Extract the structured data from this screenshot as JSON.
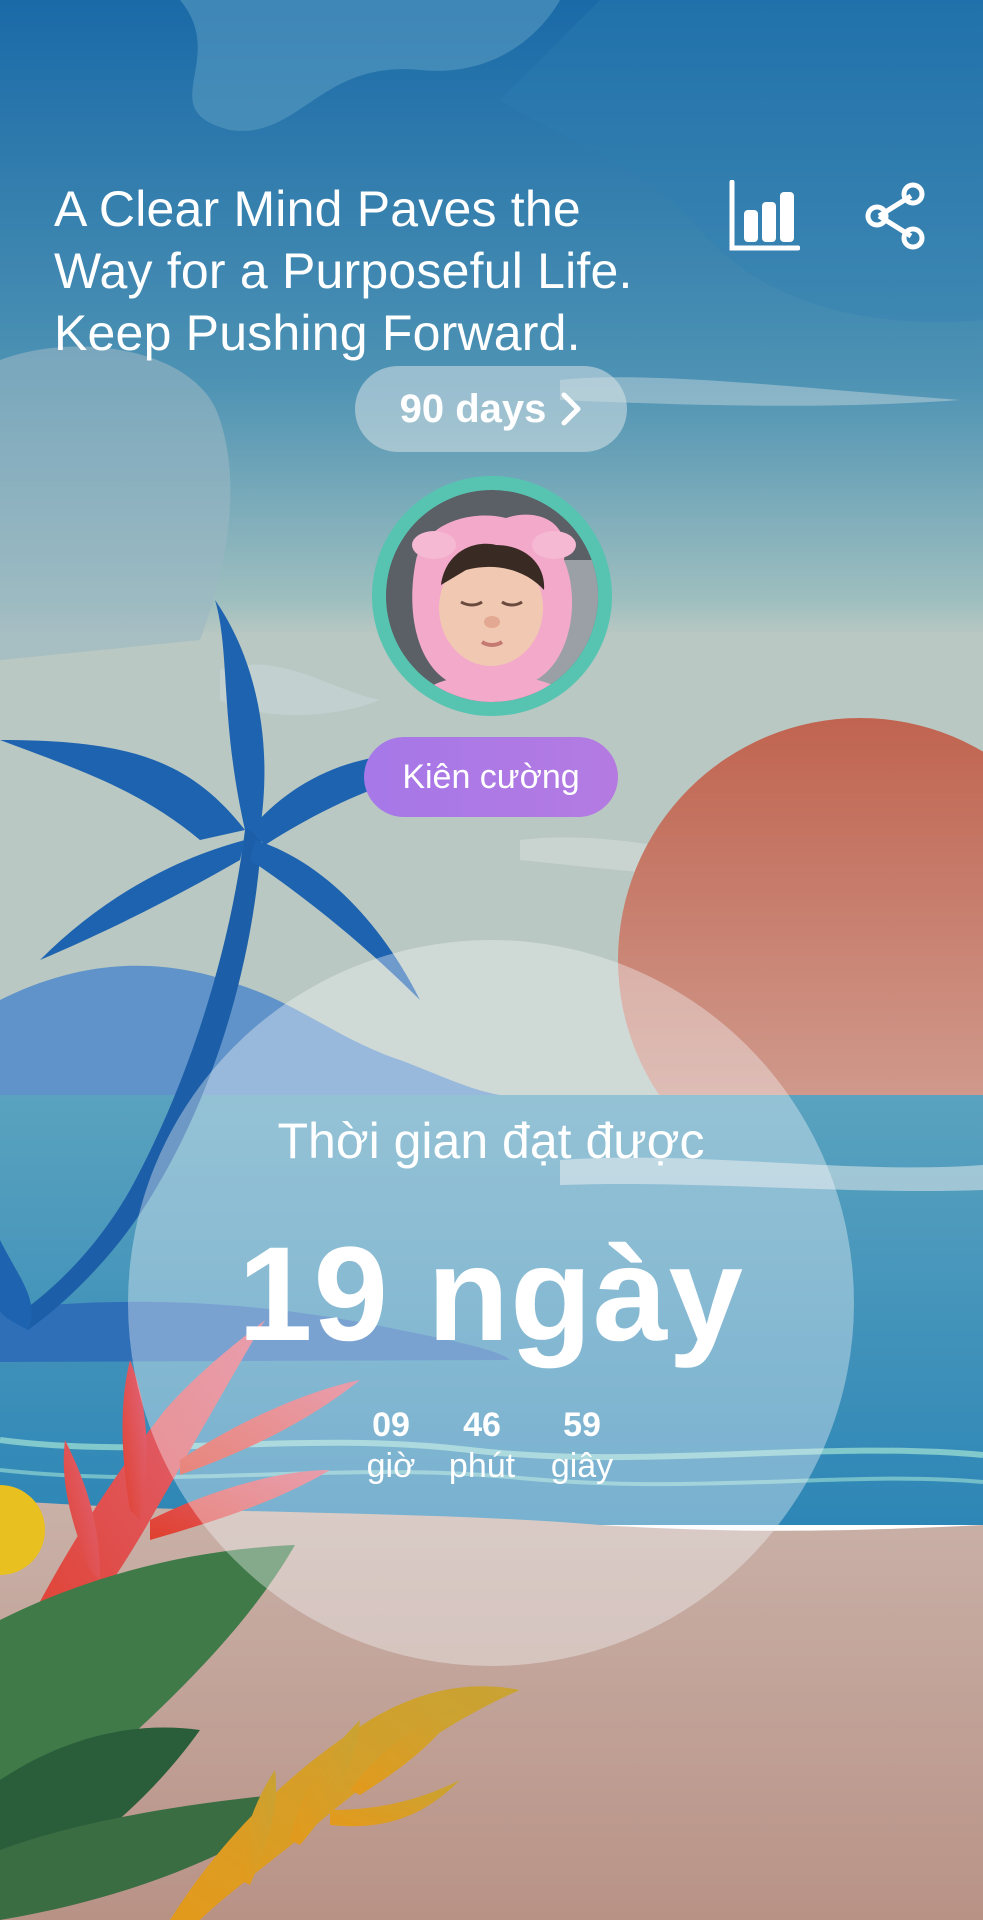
{
  "quote": "A Clear Mind Paves the\nWay for a Purposeful Life.\nKeep Pushing Forward.",
  "icons": {
    "stats": "bar-chart-icon",
    "share": "share-icon",
    "chevron": "chevron-right-icon"
  },
  "goal": {
    "label": "90 days"
  },
  "profile": {
    "status": "Kiên cường"
  },
  "progress": {
    "title": "Thời gian đạt được",
    "value": "19 ngày",
    "hours": "09",
    "hours_label": "giờ",
    "minutes": "46",
    "minutes_label": "phút",
    "seconds": "59",
    "seconds_label": "giây"
  },
  "colors": {
    "status_pill": "#a678e8",
    "avatar_ring": "#57c4b1",
    "text": "#ffffff"
  }
}
